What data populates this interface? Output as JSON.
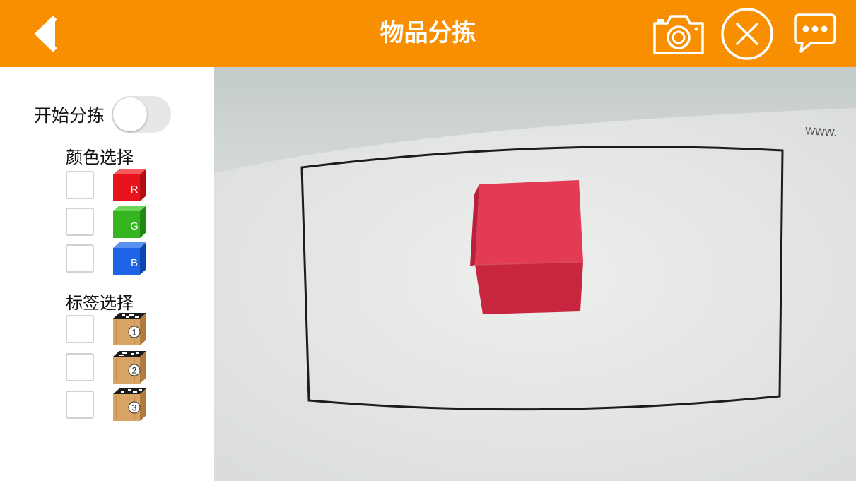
{
  "header": {
    "title": "物品分拣",
    "back_icon": "back-arrow-icon",
    "camera_icon": "camera-icon",
    "close_icon": "close-circle-icon",
    "message_icon": "message-icon",
    "bg_color": "#F78F00"
  },
  "sidebar": {
    "start_sort_label": "开始分拣",
    "start_sort_on": false,
    "color_section_label": "颜色选择",
    "colors": [
      {
        "letter": "R",
        "color": "#E8141C",
        "checked": false
      },
      {
        "letter": "G",
        "color": "#35B520",
        "checked": false
      },
      {
        "letter": "B",
        "color": "#1E64E6",
        "checked": false
      }
    ],
    "tag_section_label": "标签选择",
    "tags": [
      {
        "number": "1",
        "checked": false
      },
      {
        "number": "2",
        "checked": false
      },
      {
        "number": "3",
        "checked": false
      }
    ]
  },
  "camera": {
    "corner_text": "www.",
    "object_color": "#D9304C"
  }
}
